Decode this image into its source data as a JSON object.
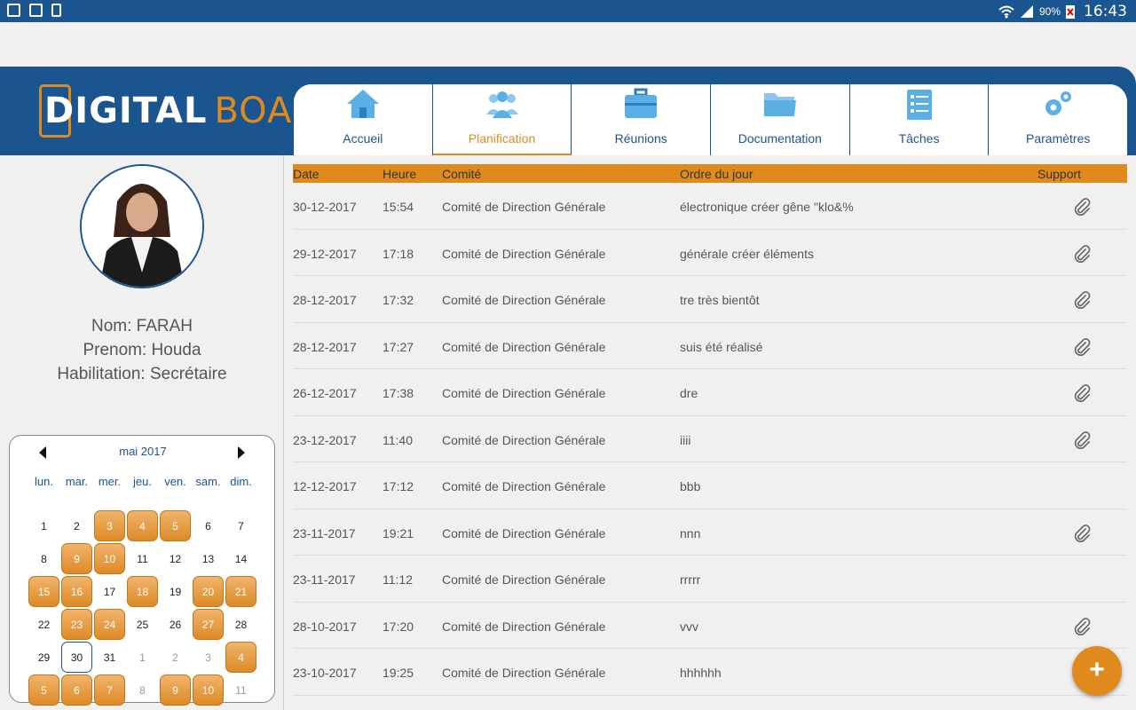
{
  "status_bar": {
    "battery": "90%",
    "time": "16:43"
  },
  "logo": {
    "digital": "DIGITAL",
    "board": "BOARD"
  },
  "tabs": [
    {
      "label": "Accueil",
      "icon": "home-icon",
      "active": false
    },
    {
      "label": "Planification",
      "icon": "users-icon",
      "active": true
    },
    {
      "label": "Réunions",
      "icon": "briefcase-icon",
      "active": false
    },
    {
      "label": "Documentation",
      "icon": "folder-icon",
      "active": false
    },
    {
      "label": "Tâches",
      "icon": "checklist-icon",
      "active": false
    },
    {
      "label": "Paramètres",
      "icon": "gears-icon",
      "active": false
    }
  ],
  "profile": {
    "nom": "Nom: FARAH",
    "prenom": "Prenom: Houda",
    "habilitation": "Habilitation: Secrétaire"
  },
  "calendar": {
    "month": "mai 2017",
    "weekdays": [
      "lun.",
      "mar.",
      "mer.",
      "jeu.",
      "ven.",
      "sam.",
      "dim."
    ],
    "days": [
      {
        "d": "1"
      },
      {
        "d": "2"
      },
      {
        "d": "3",
        "hl": true
      },
      {
        "d": "4",
        "hl": true
      },
      {
        "d": "5",
        "hl": true
      },
      {
        "d": "6"
      },
      {
        "d": "7"
      },
      {
        "d": "8"
      },
      {
        "d": "9",
        "hl": true
      },
      {
        "d": "10",
        "hl": true
      },
      {
        "d": "11"
      },
      {
        "d": "12"
      },
      {
        "d": "13"
      },
      {
        "d": "14"
      },
      {
        "d": "15",
        "hl": true
      },
      {
        "d": "16",
        "hl": true
      },
      {
        "d": "17"
      },
      {
        "d": "18",
        "hl": true
      },
      {
        "d": "19"
      },
      {
        "d": "20",
        "hl": true
      },
      {
        "d": "21",
        "hl": true
      },
      {
        "d": "22"
      },
      {
        "d": "23",
        "hl": true
      },
      {
        "d": "24",
        "hl": true
      },
      {
        "d": "25"
      },
      {
        "d": "26"
      },
      {
        "d": "27",
        "hl": true
      },
      {
        "d": "28"
      },
      {
        "d": "29"
      },
      {
        "d": "30",
        "today": true
      },
      {
        "d": "31"
      },
      {
        "d": "1",
        "other": true
      },
      {
        "d": "2",
        "other": true
      },
      {
        "d": "3",
        "other": true
      },
      {
        "d": "4",
        "other": true,
        "hl": true
      },
      {
        "d": "5",
        "other": true,
        "hl": true
      },
      {
        "d": "6",
        "other": true,
        "hl": true
      },
      {
        "d": "7",
        "other": true,
        "hl": true
      },
      {
        "d": "8",
        "other": true
      },
      {
        "d": "9",
        "other": true,
        "hl": true
      },
      {
        "d": "10",
        "other": true,
        "hl": true
      },
      {
        "d": "11",
        "other": true
      }
    ]
  },
  "table": {
    "headers": {
      "date": "Date",
      "heure": "Heure",
      "comite": "Comité",
      "ordre": "Ordre du jour",
      "support": "Support"
    },
    "rows": [
      {
        "date": "30-12-2017",
        "heure": "15:54",
        "comite": "Comité de Direction Générale",
        "ordre": "électronique créer gêne \"klo&%",
        "support": true
      },
      {
        "date": "29-12-2017",
        "heure": "17:18",
        "comite": "Comité de Direction Générale",
        "ordre": "générale créer éléments",
        "support": true
      },
      {
        "date": "28-12-2017",
        "heure": "17:32",
        "comite": "Comité de Direction Générale",
        "ordre": "tre très bientôt",
        "support": true
      },
      {
        "date": "28-12-2017",
        "heure": "17:27",
        "comite": "Comité de Direction Générale",
        "ordre": "suis été réalisé",
        "support": true
      },
      {
        "date": "26-12-2017",
        "heure": "17:38",
        "comite": "Comité de Direction Générale",
        "ordre": "dre",
        "support": true
      },
      {
        "date": "23-12-2017",
        "heure": "11:40",
        "comite": "Comité de Direction Générale",
        "ordre": "iiii",
        "support": true
      },
      {
        "date": "12-12-2017",
        "heure": "17:12",
        "comite": "Comité de Direction Générale",
        "ordre": "bbb",
        "support": false
      },
      {
        "date": "23-11-2017",
        "heure": "19:21",
        "comite": "Comité de Direction Générale",
        "ordre": "nnn",
        "support": true
      },
      {
        "date": "23-11-2017",
        "heure": "11:12",
        "comite": "Comité de Direction Générale",
        "ordre": "rrrrr",
        "support": false
      },
      {
        "date": "28-10-2017",
        "heure": "17:20",
        "comite": "Comité de Direction Générale",
        "ordre": "vvv",
        "support": true
      },
      {
        "date": "23-10-2017",
        "heure": "19:25",
        "comite": "Comité de Direction Générale",
        "ordre": "hhhhhh",
        "support": false
      }
    ]
  },
  "fab": {
    "label": "+",
    "icon": "plus-icon"
  },
  "colors": {
    "primary": "#1b5590",
    "accent": "#e08a1e"
  }
}
